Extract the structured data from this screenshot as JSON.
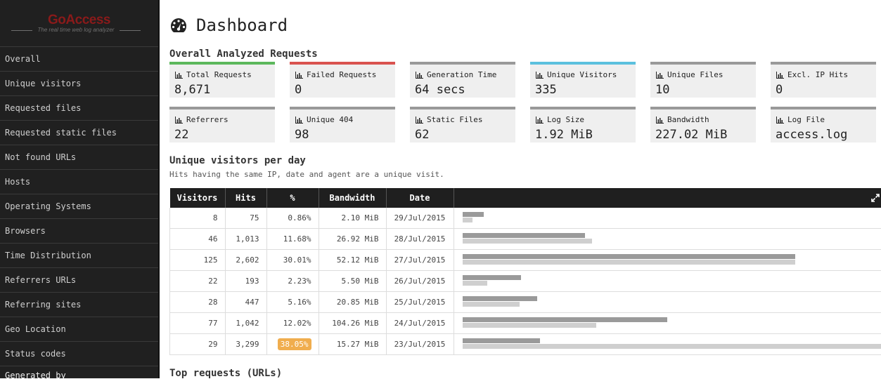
{
  "brand": {
    "name": "GoAccess",
    "tagline": "The real time web log analyzer"
  },
  "sidebar": {
    "items": [
      {
        "label": "Overall"
      },
      {
        "label": "Unique visitors"
      },
      {
        "label": "Requested files"
      },
      {
        "label": "Requested static files"
      },
      {
        "label": "Not found URLs"
      },
      {
        "label": "Hosts"
      },
      {
        "label": "Operating Systems"
      },
      {
        "label": "Browsers"
      },
      {
        "label": "Time Distribution"
      },
      {
        "label": "Referrers URLs"
      },
      {
        "label": "Referring sites"
      },
      {
        "label": "Geo Location"
      },
      {
        "label": "Status codes"
      }
    ],
    "footer": "Generated by"
  },
  "page": {
    "title": "Dashboard",
    "title_icon": "dashboard-icon",
    "overall_title": "Overall Analyzed Requests",
    "visitors_title": "Unique visitors per day",
    "visitors_desc": "Hits having the same IP, date and agent are a unique visit.",
    "next_title": "Top requests (URLs)"
  },
  "cards": [
    {
      "label": "Total Requests",
      "value": "8,671",
      "accent": "#5cb85c",
      "icon": "bar-chart-icon"
    },
    {
      "label": "Failed Requests",
      "value": "0",
      "accent": "#d9534f",
      "icon": "bar-chart-icon"
    },
    {
      "label": "Generation Time",
      "value": "64 secs",
      "accent": "#999999",
      "icon": "bar-chart-icon"
    },
    {
      "label": "Unique Visitors",
      "value": "335",
      "accent": "#5bc0de",
      "icon": "bar-chart-icon"
    },
    {
      "label": "Unique Files",
      "value": "10",
      "accent": "#999999",
      "icon": "bar-chart-icon"
    },
    {
      "label": "Excl. IP Hits",
      "value": "0",
      "accent": "#999999",
      "icon": "bar-chart-icon"
    },
    {
      "label": "Referrers",
      "value": "22",
      "accent": "#999999",
      "icon": "bar-chart-icon"
    },
    {
      "label": "Unique 404",
      "value": "98",
      "accent": "#999999",
      "icon": "bar-chart-icon"
    },
    {
      "label": "Static Files",
      "value": "62",
      "accent": "#999999",
      "icon": "bar-chart-icon"
    },
    {
      "label": "Log Size",
      "value": "1.92 MiB",
      "accent": "#999999",
      "icon": "bar-chart-icon"
    },
    {
      "label": "Bandwidth",
      "value": "227.02 MiB",
      "accent": "#999999",
      "icon": "bar-chart-icon"
    },
    {
      "label": "Log File",
      "value": "access.log",
      "accent": "#999999",
      "icon": "bar-chart-icon"
    }
  ],
  "table": {
    "headers": [
      "Visitors",
      "Hits",
      "%",
      "Bandwidth",
      "Date"
    ],
    "rows": [
      {
        "visitors": "8",
        "hits": "75",
        "pct": "0.86%",
        "bandwidth": "2.10 MiB",
        "date": "29/Jul/2015",
        "highlight": false
      },
      {
        "visitors": "46",
        "hits": "1,013",
        "pct": "11.68%",
        "bandwidth": "26.92 MiB",
        "date": "28/Jul/2015",
        "highlight": false
      },
      {
        "visitors": "125",
        "hits": "2,602",
        "pct": "30.01%",
        "bandwidth": "52.12 MiB",
        "date": "27/Jul/2015",
        "highlight": false
      },
      {
        "visitors": "22",
        "hits": "193",
        "pct": "2.23%",
        "bandwidth": "5.50 MiB",
        "date": "26/Jul/2015",
        "highlight": false
      },
      {
        "visitors": "28",
        "hits": "447",
        "pct": "5.16%",
        "bandwidth": "20.85 MiB",
        "date": "25/Jul/2015",
        "highlight": false
      },
      {
        "visitors": "77",
        "hits": "1,042",
        "pct": "12.02%",
        "bandwidth": "104.26 MiB",
        "date": "24/Jul/2015",
        "highlight": false
      },
      {
        "visitors": "29",
        "hits": "3,299",
        "pct": "38.05%",
        "bandwidth": "15.27 MiB",
        "date": "23/Jul/2015",
        "highlight": true
      }
    ],
    "highlight_color": "#f0ad4e",
    "expand_icon": "expand-icon"
  }
}
